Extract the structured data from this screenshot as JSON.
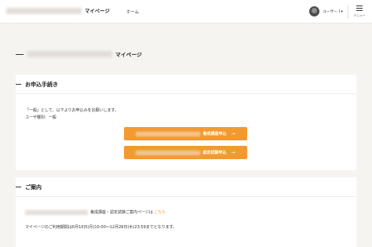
{
  "header": {
    "brand_suffix": "マイページ",
    "nav_home": "ホーム",
    "user_name": "ユーザー I ▾",
    "menu_label": "メニュー"
  },
  "page": {
    "title_suffix": "マイページ"
  },
  "application_section": {
    "title": "お申込手続き",
    "line1": "「一般」として、以下よりお申込みをお願いします。",
    "line2": "ユーザ種別：一般",
    "buttons": [
      {
        "label": "養成講座申込",
        "arrow": "→"
      },
      {
        "label": "認定試験申込",
        "arrow": "→"
      }
    ]
  },
  "guide_section": {
    "title": "ご案内",
    "line1_text": "養成講座・認定試験ご案内ページは",
    "line1_link": "こちら",
    "line2": "マイページのご利用期間は6月10日(月)10:00～12月26日(木)23:59までとなります。"
  },
  "colors": {
    "accent": "#f29a30",
    "background": "#f6f4f1"
  }
}
